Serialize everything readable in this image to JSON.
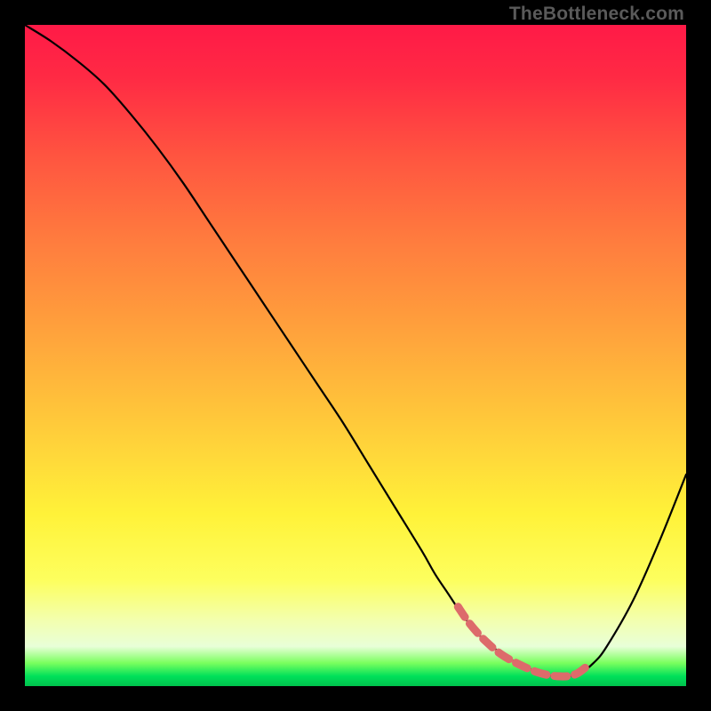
{
  "watermark": "TheBottleneck.com",
  "chart_data": {
    "type": "line",
    "title": "",
    "xlabel": "",
    "ylabel": "",
    "xlim": [
      0,
      100
    ],
    "ylim": [
      0,
      100
    ],
    "series": [
      {
        "name": "bottleneck-curve",
        "x": [
          0,
          4,
          8,
          12,
          16,
          20,
          24,
          28,
          32,
          36,
          40,
          44,
          48,
          52,
          56,
          60,
          62,
          64,
          66,
          68,
          70,
          72,
          74,
          76,
          78,
          80,
          82,
          84,
          86,
          88,
          92,
          96,
          100
        ],
        "y": [
          100,
          97.5,
          94.5,
          91,
          86.5,
          81.5,
          76,
          70,
          64,
          58,
          52,
          46,
          40,
          33.5,
          27,
          20.5,
          17,
          14,
          11,
          8.5,
          6.5,
          5,
          3.7,
          2.7,
          2,
          1.5,
          1.5,
          2,
          3.5,
          6,
          13,
          22,
          32
        ]
      },
      {
        "name": "optimal-range-marker",
        "x": [
          65.5,
          67.0,
          68.5,
          70.0,
          71.5,
          73.0,
          74.5,
          76.0,
          77.5,
          79.0,
          80.5,
          82.0,
          83.5,
          85.0
        ],
        "y": [
          12.0,
          9.8,
          8.0,
          6.5,
          5.2,
          4.2,
          3.4,
          2.7,
          2.1,
          1.7,
          1.5,
          1.5,
          1.9,
          3.0
        ]
      }
    ],
    "colors": {
      "curve": "#000000",
      "marker": "#dd6b6b",
      "gradient_top": "#ff1a47",
      "gradient_bottom": "#00c24d"
    }
  }
}
